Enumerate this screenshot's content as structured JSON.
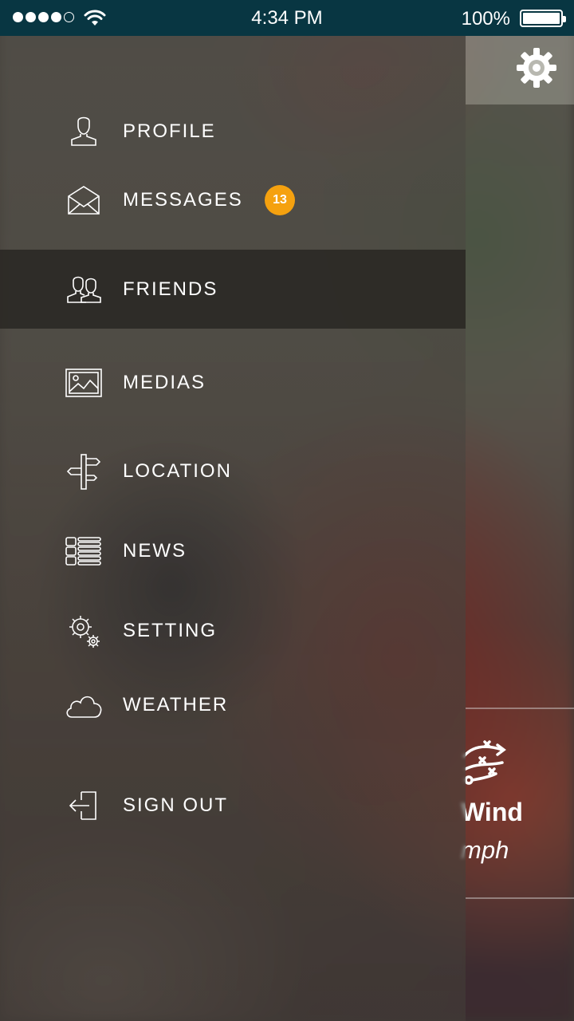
{
  "status_bar": {
    "time": "4:34 PM",
    "battery_percent": "100%",
    "signal_bars": 4,
    "signal_max": 5,
    "battery_level": 1.0
  },
  "menu": {
    "items": [
      {
        "label": "PROFILE",
        "icon": "user-icon"
      },
      {
        "label": "MESSAGES",
        "icon": "envelope-icon",
        "badge": "13"
      },
      {
        "label": "FRIENDS",
        "icon": "friends-icon",
        "active": true
      },
      {
        "label": "MEDIAS",
        "icon": "image-icon"
      },
      {
        "label": "LOCATION",
        "icon": "signpost-icon"
      },
      {
        "label": "NEWS",
        "icon": "news-list-icon"
      },
      {
        "label": "SETTING",
        "icon": "gears-icon"
      },
      {
        "label": "WEATHER",
        "icon": "cloud-icon"
      },
      {
        "label": "SIGN OUT",
        "icon": "sign-out-icon"
      }
    ]
  },
  "background": {
    "wind_label": "Wind",
    "wind_value": "mph"
  },
  "colors": {
    "status_bar": "#083642",
    "badge": "#f5a10f",
    "active_row": "#282622"
  }
}
